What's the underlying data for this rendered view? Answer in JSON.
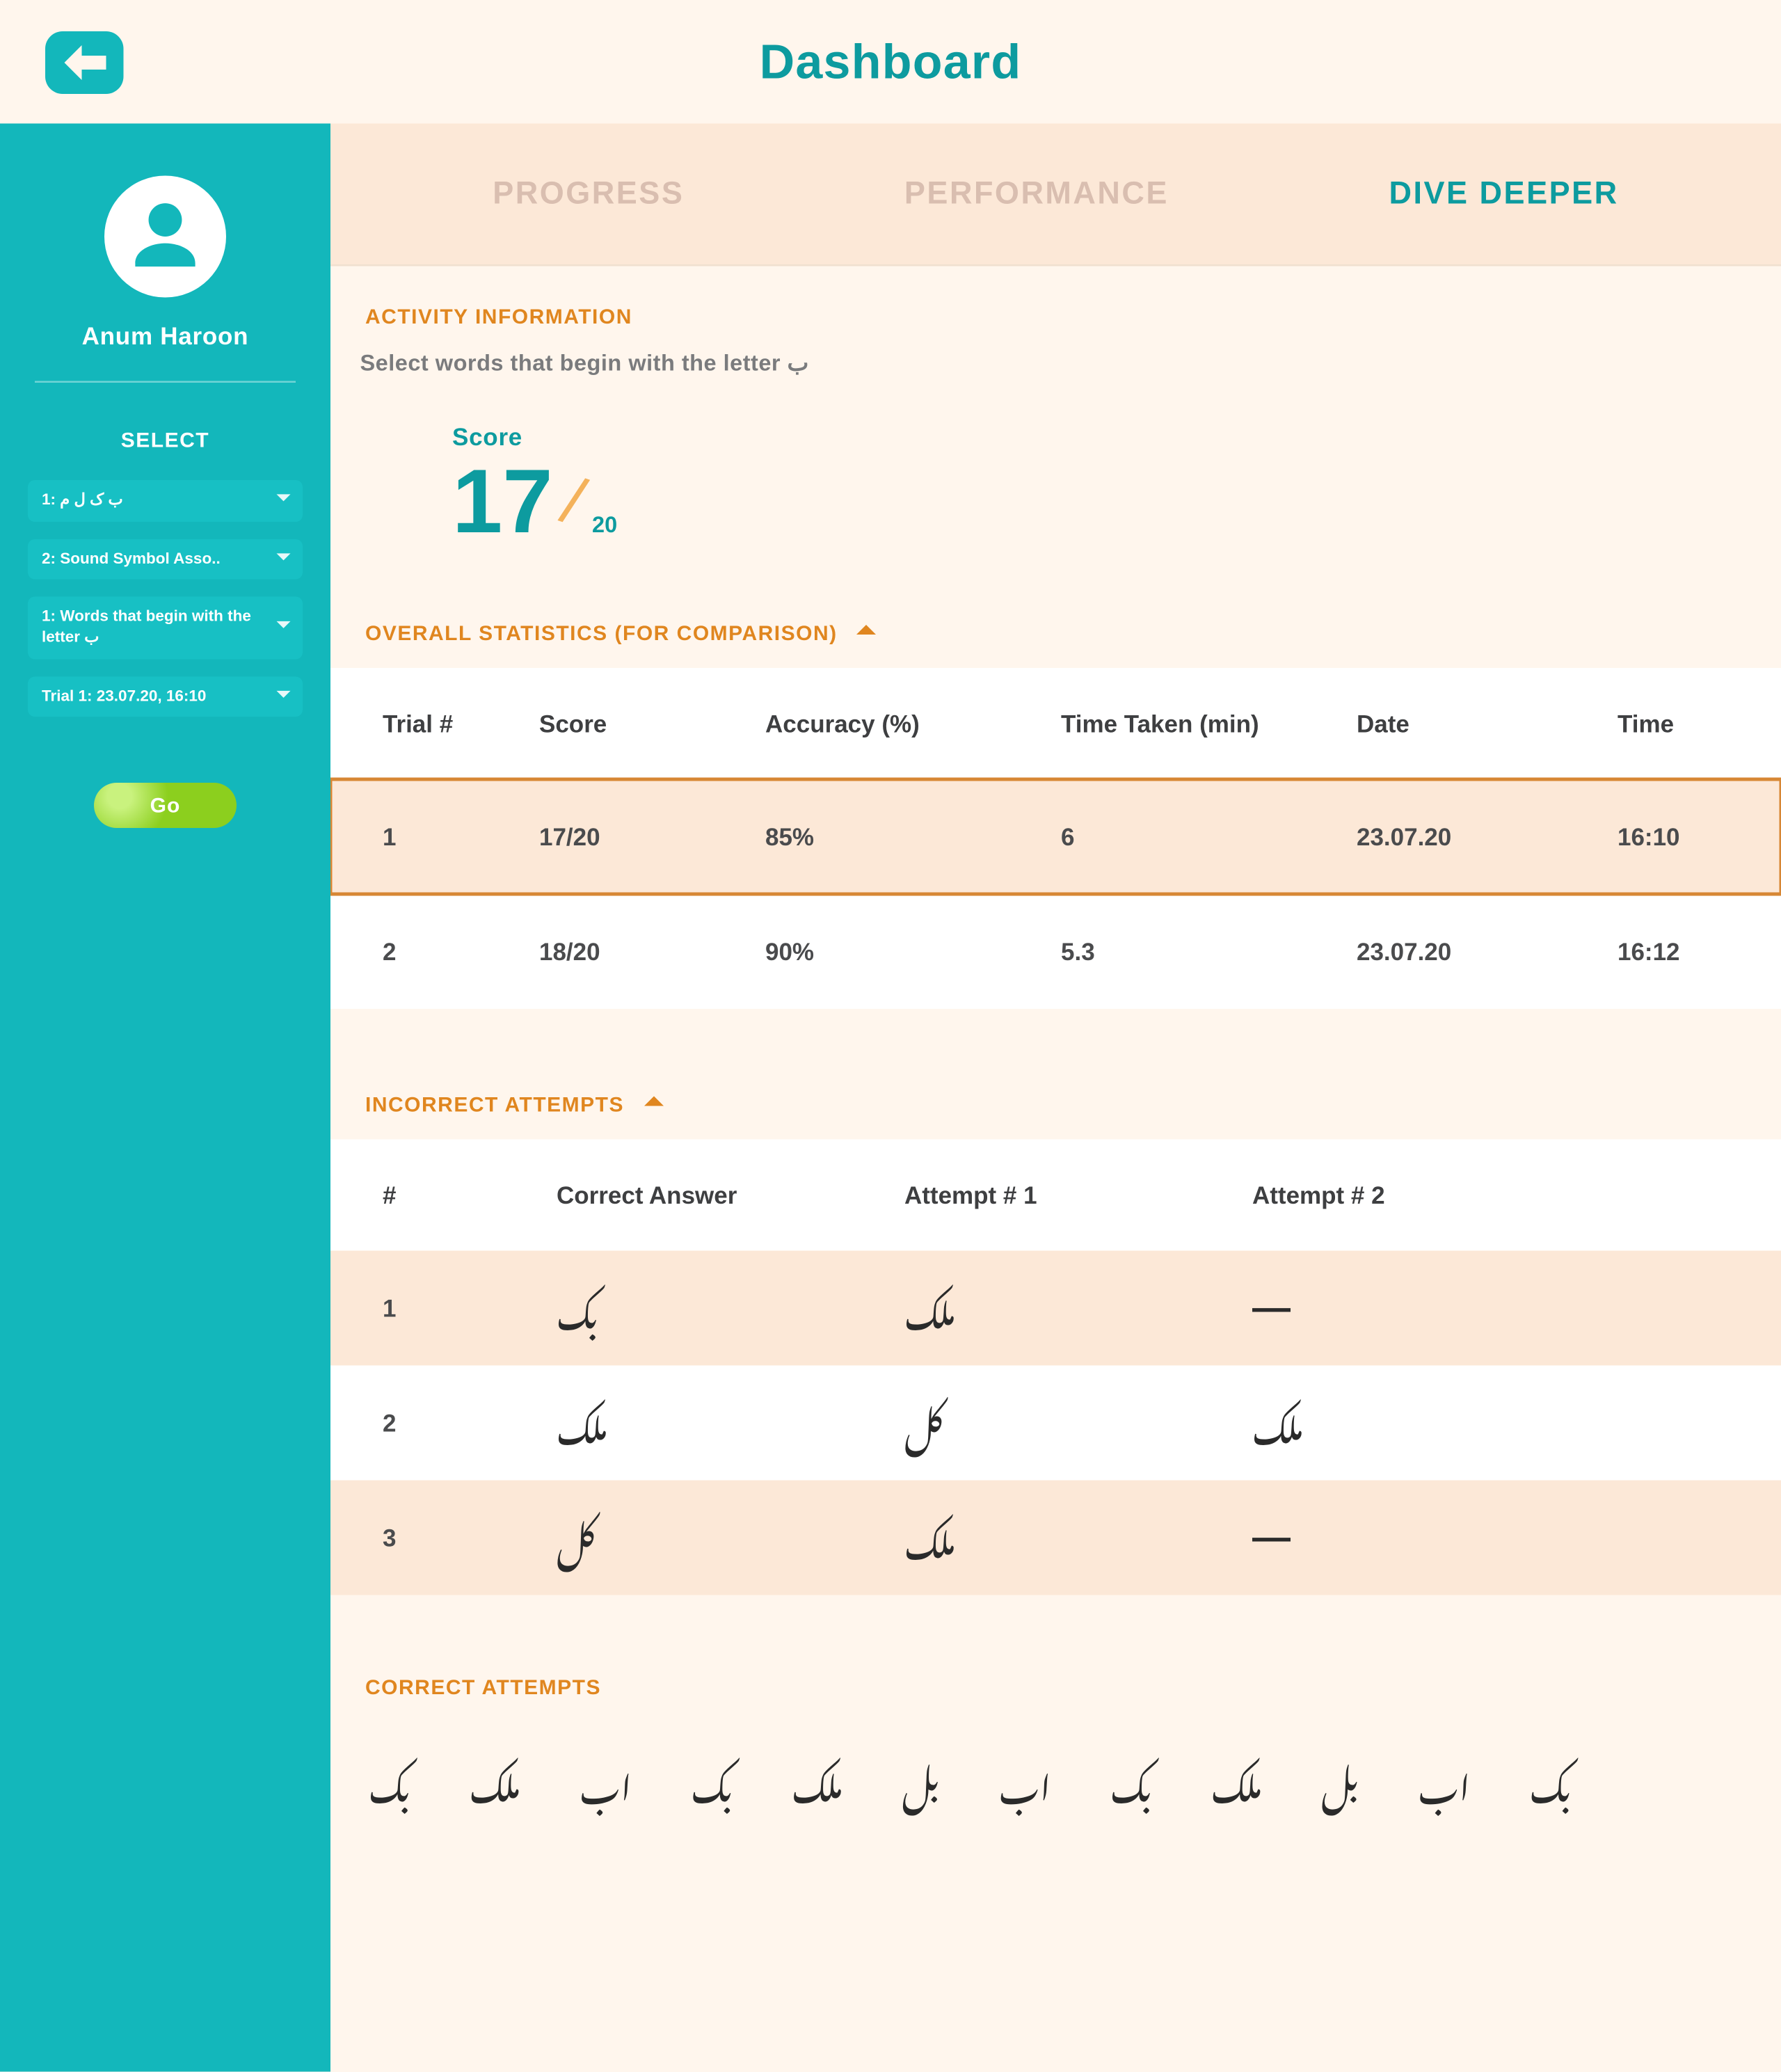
{
  "header": {
    "title": "Dashboard"
  },
  "sidebar": {
    "user_name": "Anum Haroon",
    "select_label": "SELECT",
    "dropdowns": [
      "1:    ب ک  ل م",
      "2: Sound Symbol Asso..",
      "1: Words that begin with the letter ب",
      "Trial 1: 23.07.20, 16:10"
    ],
    "go_label": "Go"
  },
  "tabs": [
    {
      "label": "PROGRESS",
      "active": false
    },
    {
      "label": "PERFORMANCE",
      "active": false
    },
    {
      "label": "DIVE DEEPER",
      "active": true
    }
  ],
  "activity": {
    "section_title": "ACTIVITY INFORMATION",
    "description": "Select words that begin with the letter ب",
    "score_label": "Score",
    "score_value": "17",
    "score_total": "20"
  },
  "stats": {
    "section_title": "OVERALL STATISTICS (FOR COMPARISON)",
    "headers": [
      "Trial #",
      "Score",
      "Accuracy (%)",
      "Time Taken (min)",
      "Date",
      "Time"
    ],
    "rows": [
      {
        "cells": [
          "1",
          "17/20",
          "85%",
          "6",
          "23.07.20",
          "16:10"
        ],
        "selected": true
      },
      {
        "cells": [
          "2",
          "18/20",
          "90%",
          "5.3",
          "23.07.20",
          "16:12"
        ],
        "selected": false
      }
    ]
  },
  "incorrect": {
    "section_title": "INCORRECT ATTEMPTS",
    "headers": [
      "#",
      "Correct Answer",
      "Attempt # 1",
      "Attempt # 2"
    ],
    "rows": [
      {
        "n": "1",
        "correct": "بک",
        "a1": "ملک",
        "a2": "—"
      },
      {
        "n": "2",
        "correct": "ملک",
        "a1": "کل",
        "a2": "ملک"
      },
      {
        "n": "3",
        "correct": "کل",
        "a1": "ملک",
        "a2": "—"
      }
    ]
  },
  "correct": {
    "section_title": "CORRECT ATTEMPTS",
    "words": [
      "بک",
      "ملک",
      "اب",
      "بک",
      "ملک",
      "بل",
      "اب",
      "بک",
      "ملک",
      "بل",
      "اب",
      "بک"
    ]
  }
}
